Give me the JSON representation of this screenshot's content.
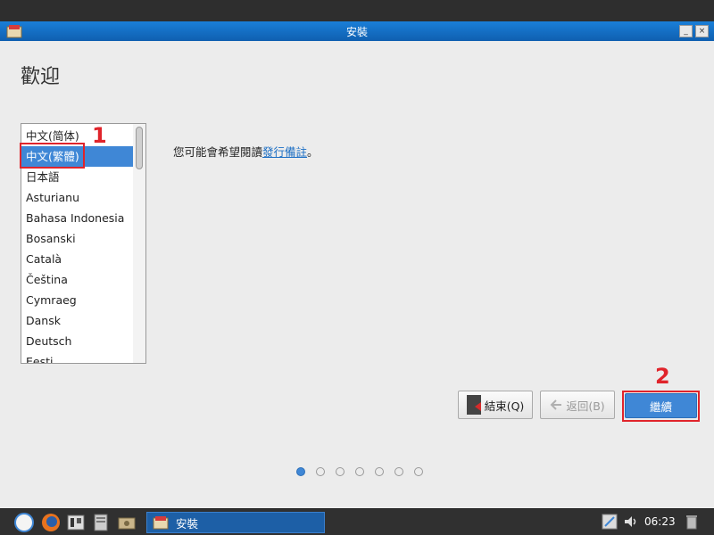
{
  "window": {
    "title": "安裝",
    "min_label": "_",
    "close_label": "×"
  },
  "page": {
    "heading": "歡迎",
    "release_prefix": "您可能會希望閱讀",
    "release_link": "發行備註",
    "release_suffix": "。"
  },
  "languages": {
    "items": [
      "中文(简体)",
      "中文(繁體)",
      "日本語",
      "Asturianu",
      "Bahasa Indonesia",
      "Bosanski",
      "Català",
      "Čeština",
      "Cymraeg",
      "Dansk",
      "Deutsch",
      "Eesti"
    ],
    "selected": "中文(繁體)"
  },
  "buttons": {
    "quit": "結束(Q)",
    "back": "返回(B)",
    "next": "繼續"
  },
  "annotations": {
    "one": "1",
    "two": "2"
  },
  "steps": {
    "count": 7,
    "active": 1
  },
  "taskbar": {
    "task_label": "安裝",
    "clock": "06:23"
  },
  "colors": {
    "accent": "#3f87d6",
    "annotation": "#e0242b",
    "titlebar": "#1a7fd8"
  }
}
